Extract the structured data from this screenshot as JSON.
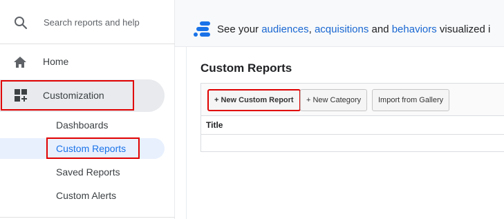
{
  "search": {
    "placeholder": "Search reports and help",
    "icon": "search-icon"
  },
  "nav": {
    "home": {
      "label": "Home",
      "icon": "home-icon"
    },
    "customization": {
      "label": "Customization",
      "icon": "dashboard-add-icon",
      "children": [
        {
          "label": "Dashboards",
          "active": false
        },
        {
          "label": "Custom Reports",
          "active": true
        },
        {
          "label": "Saved Reports",
          "active": false
        },
        {
          "label": "Custom Alerts",
          "active": false
        }
      ]
    }
  },
  "banner": {
    "icon": "analytics-logo-icon",
    "see_your": "See your ",
    "link_audiences": "audiences",
    "comma": ", ",
    "link_acquisitions": "acquisitions",
    "and": " and ",
    "link_behaviors": "behaviors",
    "suffix": " visualized i"
  },
  "main": {
    "title": "Custom Reports",
    "buttons": {
      "new_report": "+ New Custom Report",
      "new_category": "+ New Category",
      "import": "Import from Gallery"
    },
    "table": {
      "headers": [
        "Title"
      ]
    }
  },
  "colors": {
    "accent": "#1a73e8",
    "link": "#1967d2",
    "highlight": "#e00000",
    "active_bg": "#e8f0fe",
    "selected_bg": "#e8eaed"
  }
}
